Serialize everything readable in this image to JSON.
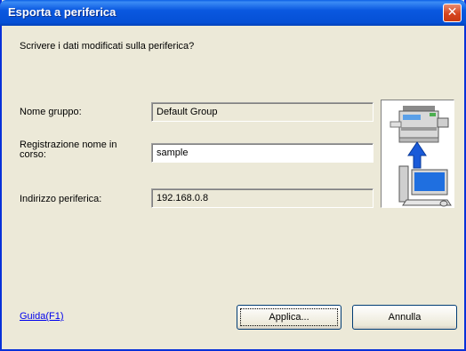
{
  "window": {
    "title": "Esporta a periferica",
    "close_glyph": "✕"
  },
  "dialog": {
    "prompt": "Scrivere i dati modificati sulla periferica?",
    "fields": [
      {
        "label": "Nome gruppo:",
        "value": "Default Group"
      },
      {
        "label_line1": "Registrazione nome in",
        "label_line2": "corso:",
        "value": "sample"
      },
      {
        "label": "Indirizzo periferica:",
        "value": "192.168.0.8"
      }
    ],
    "illustration": "printer-to-computer-export-icon"
  },
  "buttons": {
    "help": "Guida(F1)",
    "apply": "Applica...",
    "cancel": "Annulla"
  },
  "colors": {
    "titlebar": "#0550d5",
    "close": "#d6451e",
    "face": "#ece9d8",
    "link": "#0000ee",
    "arrow": "#1a5ad8"
  }
}
